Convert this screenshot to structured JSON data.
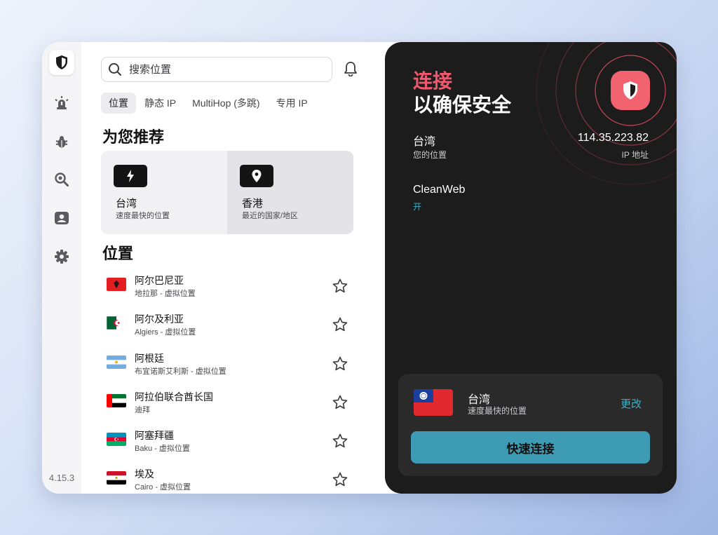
{
  "app": {
    "version": "4.15.3",
    "sidebar": {
      "items": [
        {
          "icon": "shield-icon",
          "active": true
        },
        {
          "icon": "alert-lamp-icon",
          "active": false
        },
        {
          "icon": "bug-icon",
          "active": false
        },
        {
          "icon": "search-magnifier-icon",
          "active": false
        },
        {
          "icon": "user-card-icon",
          "active": false
        },
        {
          "icon": "gear-icon",
          "active": false
        }
      ]
    }
  },
  "search": {
    "placeholder": "搜索位置",
    "value": ""
  },
  "tabs": [
    {
      "label": "位置",
      "active": true
    },
    {
      "label": "静态 IP",
      "active": false
    },
    {
      "label": "MultiHop (多跳)",
      "active": false
    },
    {
      "label": "专用 IP",
      "active": false
    }
  ],
  "recommend": {
    "title": "为您推荐",
    "cards": [
      {
        "icon": "lightning-icon",
        "name": "台湾",
        "sub": "速度最快的位置"
      },
      {
        "icon": "location-pin-icon",
        "name": "香港",
        "sub": "最近的国家/地区"
      }
    ]
  },
  "locations": {
    "title": "位置",
    "items": [
      {
        "name": "阿尔巴尼亚",
        "sub": "地拉那 - 虚拟位置",
        "flag": "albania"
      },
      {
        "name": "阿尔及利亚",
        "sub": "Algiers - 虚拟位置",
        "flag": "algeria"
      },
      {
        "name": "阿根廷",
        "sub": "布宜诺斯艾利斯 - 虚拟位置",
        "flag": "argentina"
      },
      {
        "name": "阿拉伯联合酋长国",
        "sub": "迪拜",
        "flag": "uae"
      },
      {
        "name": "阿塞拜疆",
        "sub": "Baku - 虚拟位置",
        "flag": "azerbaijan"
      },
      {
        "name": "埃及",
        "sub": "Cairo - 虚拟位置",
        "flag": "egypt"
      }
    ]
  },
  "status": {
    "title_line1": "连接",
    "title_line2": "以确保安全",
    "location_value": "台湾",
    "location_label": "您的位置",
    "ip_value": "114.35.223.82",
    "ip_label": "IP 地址",
    "cleanweb_title": "CleanWeb",
    "cleanweb_status": "开"
  },
  "connect": {
    "location": "台湾",
    "sub": "速度最快的位置",
    "change_label": "更改",
    "button_label": "快速连接"
  },
  "colors": {
    "accent_red": "#f0586e",
    "accent_teal": "#3d9cb3",
    "link_teal": "#39b1c9",
    "panel_bg": "#1c1c1d"
  }
}
